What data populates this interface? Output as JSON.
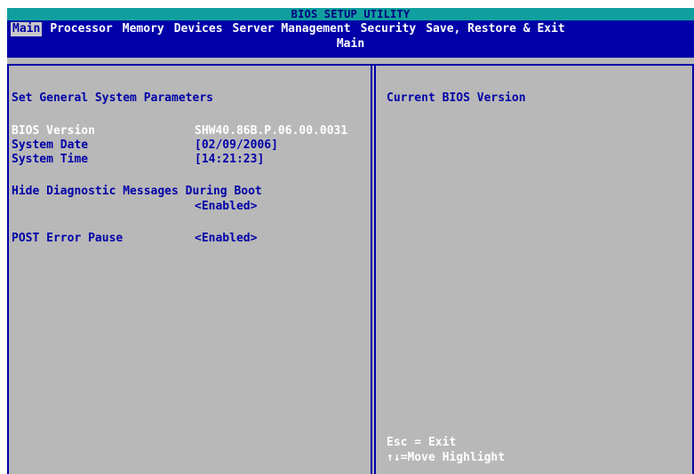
{
  "title": "BIOS SETUP UTILITY",
  "menu": {
    "tabs": [
      {
        "label": "Main",
        "active": true
      },
      {
        "label": "Processor",
        "active": false
      },
      {
        "label": "Memory",
        "active": false
      },
      {
        "label": "Devices",
        "active": false
      },
      {
        "label": "Server Management",
        "active": false
      },
      {
        "label": "Security",
        "active": false
      },
      {
        "label": "Save, Restore & Exit",
        "active": false
      }
    ],
    "current_page": "Main"
  },
  "left_panel": {
    "heading": "Set General System Parameters",
    "bios_version_label": "BIOS Version",
    "bios_version_value": "SHW40.86B.P.06.00.0031",
    "system_date_label": "System Date",
    "system_date_value": "[02/09/2006]",
    "system_time_label": "System Time",
    "system_time_value": "[14:21:23]",
    "hide_diag_label": "Hide Diagnostic Messages During Boot",
    "hide_diag_value": "<Enabled>",
    "post_error_label": "POST Error Pause",
    "post_error_value": "<Enabled>"
  },
  "right_panel": {
    "help_text": "Current BIOS Version",
    "key_help": [
      "Esc = Exit",
      "↑↓=Move Highlight"
    ]
  },
  "colors": {
    "title_bar": "#109f9f",
    "menu_bar": "#0000a8",
    "panel": "#b8b8b8",
    "text": "#0000a8",
    "highlight_text": "#ffffff"
  }
}
